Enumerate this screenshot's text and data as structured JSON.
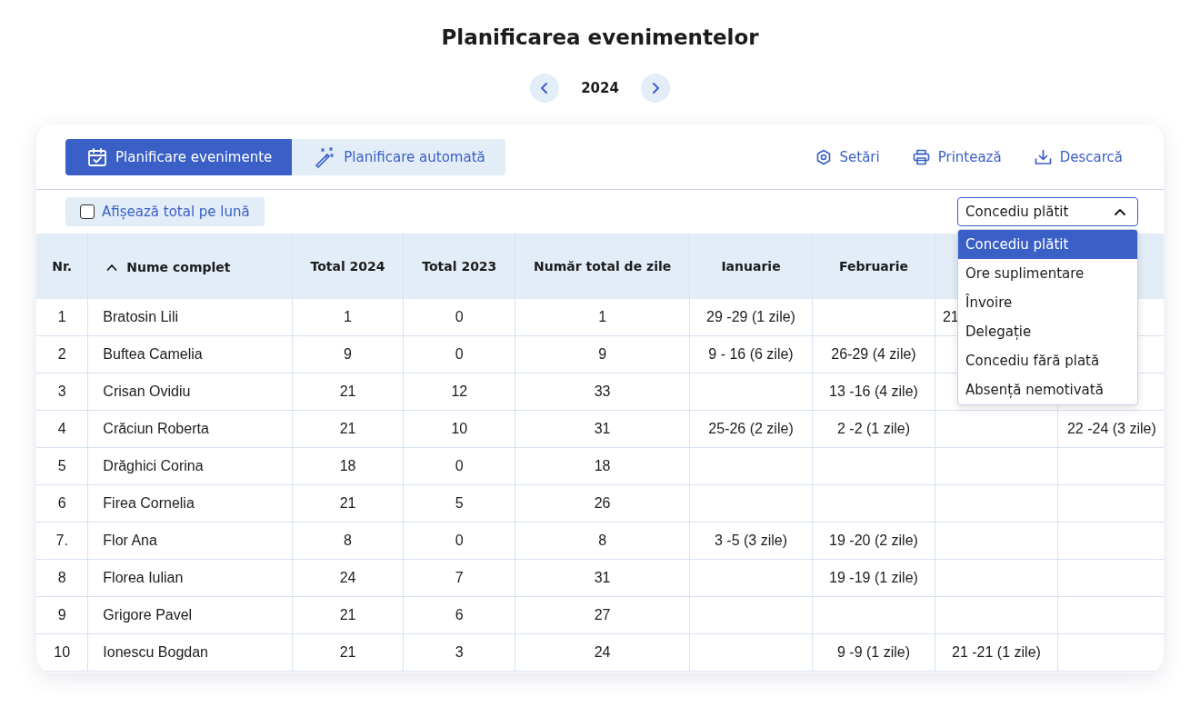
{
  "title": "Planificarea evenimentelor",
  "year": "2024",
  "tabs": [
    {
      "label": "Planificare evenimente",
      "selected": true,
      "kind": "calendar"
    },
    {
      "label": "Planificare automată",
      "selected": false,
      "kind": "wand"
    }
  ],
  "actions": [
    {
      "label": "Setări",
      "kind": "settings"
    },
    {
      "label": "Printează",
      "kind": "print"
    },
    {
      "label": "Descarcă",
      "kind": "download"
    }
  ],
  "monthly_total": {
    "label": "Afișează total pe lună",
    "checked": false
  },
  "event_type": {
    "value": "Concediu plătit",
    "expanded": true,
    "options": [
      {
        "label": "Concediu plătit",
        "selected": true
      },
      {
        "label": "Ore suplimentare",
        "selected": false
      },
      {
        "label": "Învoire",
        "selected": false
      },
      {
        "label": "Delegație",
        "selected": false
      },
      {
        "label": "Concediu fără plată",
        "selected": false
      },
      {
        "label": "Absență nemotivată",
        "selected": false
      }
    ]
  },
  "table": {
    "columns": [
      {
        "label": "Nr."
      },
      {
        "label": "Nume complet",
        "sorted_ascending": true
      },
      {
        "label": "Total 2024"
      },
      {
        "label": "Total 2023"
      },
      {
        "label": "Număr total de zile"
      },
      {
        "label": "Ianuarie"
      },
      {
        "label": "Februarie"
      }
    ],
    "rows": [
      {
        "nr": "1",
        "name": "Bratosin Lili",
        "total_2024": "1",
        "total_2023": "0",
        "total_days": "1",
        "ianuarie": "29 -29 (1 zile)",
        "column_8": "21"
      },
      {
        "nr": "2",
        "name": "Buftea Camelia",
        "total_2024": "9",
        "total_2023": "0",
        "total_days": "9",
        "ianuarie": "9 - 16 (6 zile)",
        "februarie": "26-29 (4 zile)"
      },
      {
        "nr": "3",
        "name": "Crisan Ovidiu",
        "total_2024": "21",
        "total_2023": "12",
        "total_days": "33",
        "februarie": "13 -16 (4 zile)"
      },
      {
        "nr": "4",
        "name": "Crăciun Roberta",
        "total_2024": "21",
        "total_2023": "10",
        "total_days": "31",
        "ianuarie": "25-26 (2 zile)",
        "februarie": "2 -2 (1 zile)",
        "column_9": "22 -24 (3 zile)"
      },
      {
        "nr": "5",
        "name": "Drăghici Corina",
        "total_2024": "18",
        "total_2023": "0",
        "total_days": "18"
      },
      {
        "nr": "6",
        "name": "Firea Cornelia",
        "total_2024": "21",
        "total_2023": "5",
        "total_days": "26"
      },
      {
        "nr": "7.",
        "name": "Flor Ana",
        "total_2024": "8",
        "total_2023": "0",
        "total_days": "8",
        "ianuarie": "3 -5 (3 zile)",
        "februarie": "19 -20 (2 zile)"
      },
      {
        "nr": "8",
        "name": "Florea Iulian",
        "total_2024": "24",
        "total_2023": "7",
        "total_days": "31",
        "februarie": "19 -19 (1 zile)"
      },
      {
        "nr": "9",
        "name": "Grigore Pavel",
        "total_2024": "21",
        "total_2023": "6",
        "total_days": "27"
      },
      {
        "nr": "10",
        "name": "Ionescu Bogdan",
        "total_2024": "21",
        "total_2023": "3",
        "total_days": "24",
        "februarie": "9 -9 (1 zile)",
        "column_8": "21 -21 (1 zile)"
      }
    ]
  }
}
